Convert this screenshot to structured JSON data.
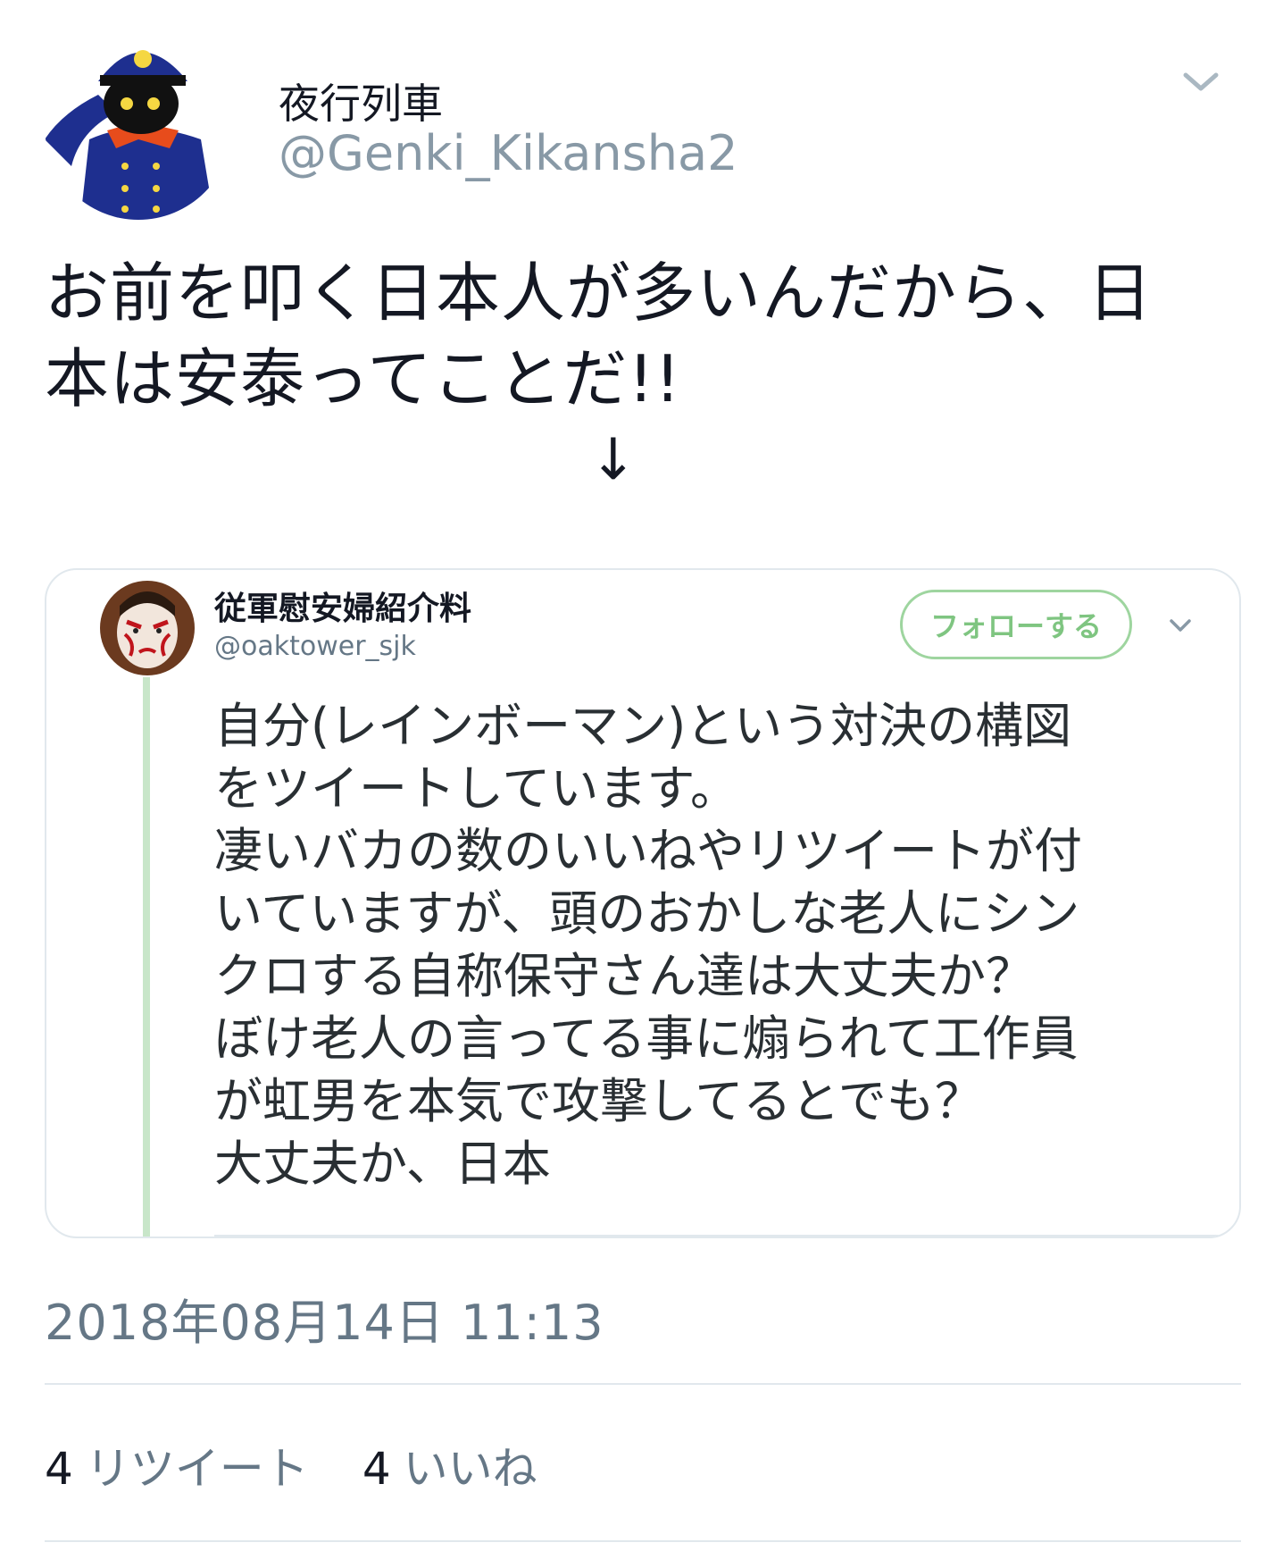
{
  "author": {
    "name": "夜行列車",
    "handle": "@Genki_Kikansha2"
  },
  "tweet": {
    "text_line1": "お前を叩く日本人が多いんだから、日",
    "text_line2": "本は安泰ってことだ!!",
    "arrow": "↓"
  },
  "quoted": {
    "name": "従軍慰安婦紹介料",
    "handle": "@oaktower_sjk",
    "follow_label": "フォローする",
    "lines": [
      "自分(レインボーマン)という対決の構図",
      "をツイートしています。",
      "凄いバカの数のいいねやリツイートが付",
      "いていますが、頭のおかしな老人にシン",
      "クロする自称保守さん達は大丈夫か？",
      "ぼけ老人の言ってる事に煽られて工作員",
      "が虹男を本気で攻撃してるとでも？",
      "大丈夫か、日本"
    ],
    "accent_color": "#7fc581"
  },
  "meta": {
    "timestamp": "2018年08月14日  11:13"
  },
  "stats": {
    "retweet_count": "4",
    "retweet_label": "リツイート",
    "like_count": "4",
    "like_label": "いいね"
  },
  "icons": {
    "header_chevron": "chevron-down-icon",
    "quote_chevron": "chevron-down-icon"
  }
}
